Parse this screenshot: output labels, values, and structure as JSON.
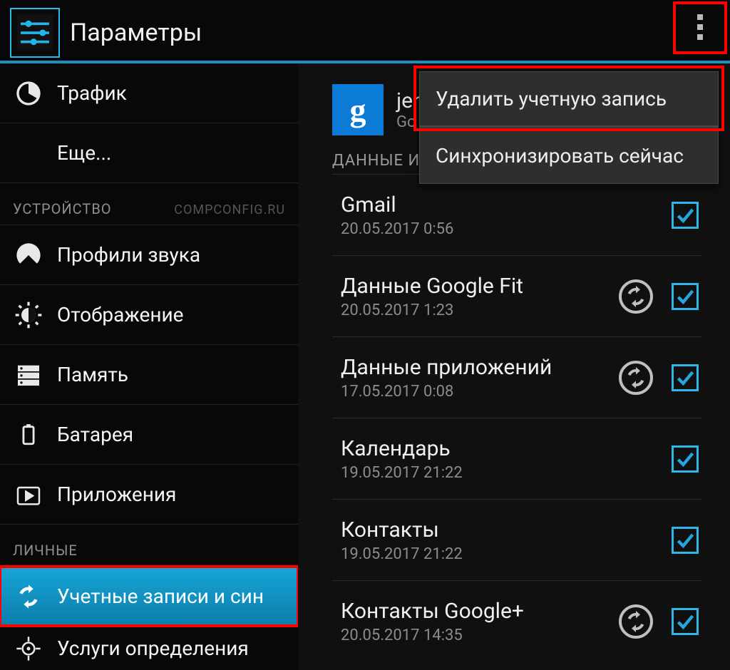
{
  "header": {
    "title": "Параметры"
  },
  "popup": {
    "delete": "Удалить учетную запись",
    "sync_now": "Синхронизировать сейчас"
  },
  "left": {
    "traffic": "Трафик",
    "more": "Еще...",
    "section_device": "УСТРОЙСТВО",
    "watermark": "COMPCONFIG.RU",
    "sound_profiles": "Профили звука",
    "display": "Отображение",
    "storage": "Память",
    "battery": "Батарея",
    "apps": "Приложения",
    "section_personal": "ЛИЧНЫЕ",
    "accounts_sync": "Учетные записи и син",
    "location": "Услуги определения "
  },
  "right": {
    "account_name_fragment": "jen",
    "account_sub_fragment": "Go",
    "section_data_fragment": "ДАННЫЕ И",
    "items": [
      {
        "title": "Gmail",
        "time": "20.05.2017 0:56",
        "refresh": false,
        "checked": true
      },
      {
        "title": "Данные Google Fit",
        "time": "20.05.2017 1:23",
        "refresh": true,
        "checked": true
      },
      {
        "title": "Данные приложений",
        "time": "17.05.2017 0:08",
        "refresh": true,
        "checked": true
      },
      {
        "title": "Календарь",
        "time": "19.05.2017 21:22",
        "refresh": false,
        "checked": true
      },
      {
        "title": "Контакты",
        "time": "19.05.2017 21:22",
        "refresh": false,
        "checked": true
      },
      {
        "title": "Контакты Google+",
        "time": "20.05.2017 14:35",
        "refresh": true,
        "checked": true
      }
    ]
  }
}
